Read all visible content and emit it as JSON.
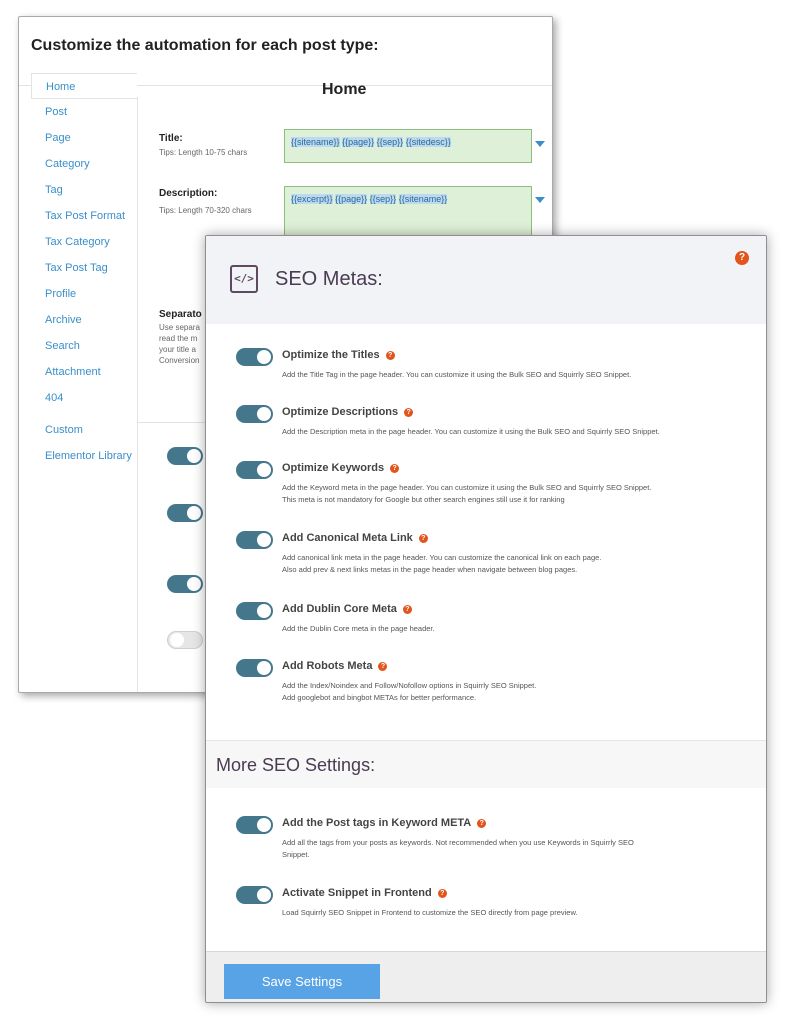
{
  "automation": {
    "heading": "Customize the automation for each post type:",
    "post_types": [
      "Home",
      "Post",
      "Page",
      "Category",
      "Tag",
      "Tax Post Format",
      "Tax Category",
      "Tax Post Tag",
      "Profile",
      "Archive",
      "Search",
      "Attachment",
      "404",
      "Custom",
      "Elementor Library"
    ],
    "active_type": "Home",
    "section_title": "Home",
    "title_field": {
      "label": "Title:",
      "tip": "Tips: Length 10-75 chars",
      "tokens": [
        "{{sitename}}",
        "{{page}}",
        "{{sep}}",
        "{{sitedesc}}"
      ]
    },
    "description_field": {
      "label": "Description:",
      "tip": "Tips: Length 70-320 chars",
      "tokens": [
        "{{excerpt}}",
        "{{page}}",
        "{{sep}}",
        "{{sitename}}"
      ]
    },
    "separator": {
      "label": "Separato",
      "text_lines": [
        "Use separa",
        "read the m",
        "your title a",
        "Conversion"
      ]
    }
  },
  "seo_metas": {
    "title": "SEO Metas:",
    "icon": "code-icon",
    "options": [
      {
        "title": "Optimize the Titles",
        "enabled": true,
        "desc": [
          "Add the Title Tag in the page header. You can customize it using the Bulk SEO and Squirrly SEO Snippet."
        ]
      },
      {
        "title": "Optimize Descriptions",
        "enabled": true,
        "desc": [
          "Add the Description meta in the page header. You can customize it using the Bulk SEO and Squirrly SEO Snippet."
        ]
      },
      {
        "title": "Optimize Keywords",
        "enabled": true,
        "desc": [
          "Add the Keyword meta in the page header. You can customize it using the Bulk SEO and Squirrly SEO Snippet.",
          "This meta is not mandatory for Google but other search engines still use it for ranking"
        ]
      },
      {
        "title": "Add Canonical Meta Link",
        "enabled": true,
        "desc": [
          "Add canonical link meta in the page header. You can customize the canonical link on each page.",
          "Also add prev & next links metas in the page header when navigate between blog pages."
        ]
      },
      {
        "title": "Add Dublin Core Meta",
        "enabled": true,
        "desc": [
          "Add the Dublin Core meta in the page header."
        ]
      },
      {
        "title": "Add Robots Meta",
        "enabled": true,
        "desc": [
          "Add the Index/Noindex and Follow/Nofollow options in Squirrly SEO Snippet.",
          "Add googlebot and bingbot METAs for better performance."
        ]
      }
    ]
  },
  "more_settings": {
    "title": "More SEO Settings:",
    "options": [
      {
        "title": "Add the Post tags in Keyword META",
        "enabled": true,
        "desc": [
          "Add all the tags from your posts as keywords. Not recommended when you use Keywords in Squirrly SEO",
          "Snippet."
        ]
      },
      {
        "title": "Activate Snippet in Frontend",
        "enabled": true,
        "desc": [
          "Load Squirrly SEO Snippet in Frontend to customize the SEO directly from page preview."
        ]
      }
    ]
  },
  "footer": {
    "save_label": "Save Settings"
  },
  "colors": {
    "toggle_on": "#44778b",
    "help_orange": "#e2541a",
    "link_blue": "#3a8fc9",
    "save_blue": "#58a3e6"
  }
}
